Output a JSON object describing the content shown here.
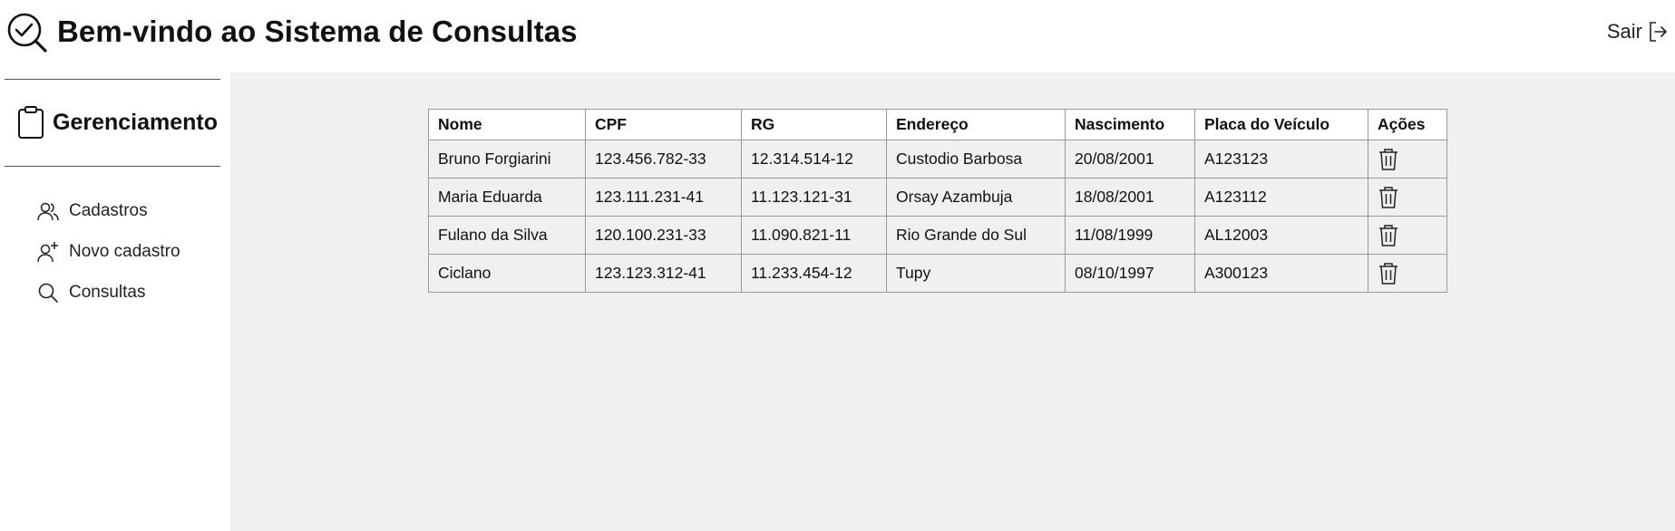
{
  "header": {
    "title": "Bem-vindo ao Sistema de Consultas",
    "logo_icon": "search-check-icon",
    "logout_label": "Sair",
    "logout_icon": "logout-icon"
  },
  "sidebar": {
    "section": {
      "label": "Gerenciamento",
      "icon": "clipboard-icon"
    },
    "items": [
      {
        "label": "Cadastros",
        "icon": "users-icon"
      },
      {
        "label": "Novo cadastro",
        "icon": "user-plus-icon"
      },
      {
        "label": "Consultas",
        "icon": "search-icon"
      }
    ]
  },
  "table": {
    "columns": [
      "Nome",
      "CPF",
      "RG",
      "Endereço",
      "Nascimento",
      "Placa do Veículo",
      "Ações"
    ],
    "rows": [
      {
        "nome": "Bruno Forgiarini",
        "cpf": "123.456.782-33",
        "rg": "12.314.514-12",
        "endereco": "Custodio Barbosa",
        "nascimento": "20/08/2001",
        "placa": "A123123",
        "action_icon": "trash-icon"
      },
      {
        "nome": "Maria Eduarda",
        "cpf": "123.111.231-41",
        "rg": "11.123.121-31",
        "endereco": "Orsay Azambuja",
        "nascimento": "18/08/2001",
        "placa": "A123112",
        "action_icon": "trash-icon"
      },
      {
        "nome": "Fulano da Silva",
        "cpf": "120.100.231-33",
        "rg": "11.090.821-11",
        "endereco": "Rio Grande do Sul",
        "nascimento": "11/08/1999",
        "placa": "AL12003",
        "action_icon": "trash-icon"
      },
      {
        "nome": "Ciclano",
        "cpf": "123.123.312-41",
        "rg": "11.233.454-12",
        "endereco": "Tupy",
        "nascimento": "08/10/1997",
        "placa": "A300123",
        "action_icon": "trash-icon"
      }
    ]
  },
  "colors": {
    "main_background": "#f0f0f0",
    "border": "#9a9a9a",
    "text": "#111111"
  }
}
